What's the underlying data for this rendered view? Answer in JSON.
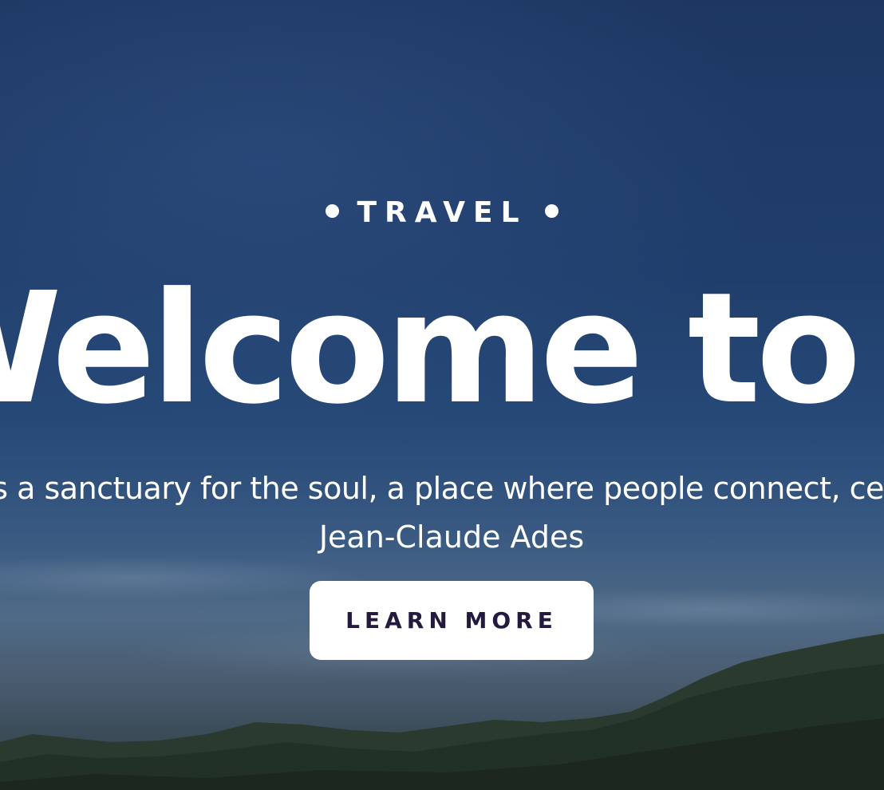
{
  "hero": {
    "kicker": "TRAVEL",
    "headline": "Welcome to Ibiza",
    "quote": "Ibiza is a sanctuary for the soul, a place where people connect, celebrate, and",
    "author": "Jean-Claude Ades",
    "cta_label": "LEARN MORE"
  },
  "colors": {
    "sky_overlay": "#1f3a66",
    "text": "#ffffff",
    "button_background": "#ffffff",
    "button_text": "#24193f"
  }
}
